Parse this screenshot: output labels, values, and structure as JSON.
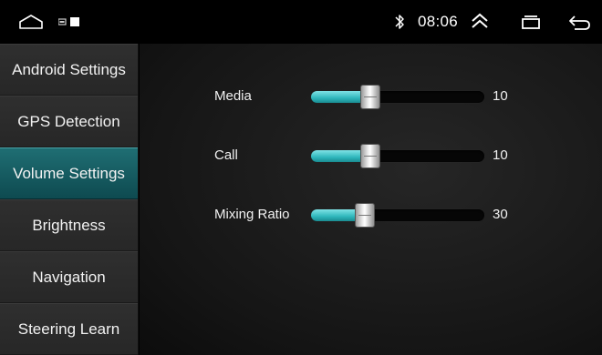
{
  "status_bar": {
    "time": "08:06",
    "icons": [
      "home-icon",
      "notification-icons",
      "bluetooth-icon",
      "expand-up-icon",
      "recent-apps-icon",
      "back-icon"
    ]
  },
  "sidebar": {
    "items": [
      {
        "label": "Android Settings",
        "active": false
      },
      {
        "label": "GPS Detection",
        "active": false
      },
      {
        "label": "Volume Settings",
        "active": true
      },
      {
        "label": "Brightness",
        "active": false
      },
      {
        "label": "Navigation",
        "active": false
      },
      {
        "label": "Steering Learn",
        "active": false
      }
    ]
  },
  "volume": {
    "sliders": [
      {
        "label": "Media",
        "value": "10",
        "level_fraction": 0.34
      },
      {
        "label": "Call",
        "value": "10",
        "level_fraction": 0.34
      },
      {
        "label": "Mixing Ratio",
        "value": "30",
        "level_fraction": 0.31
      }
    ]
  },
  "colors": {
    "accent": "#2fb7bc",
    "active_item": "#17626a",
    "sidebar_bg": "#2b2b2b"
  }
}
